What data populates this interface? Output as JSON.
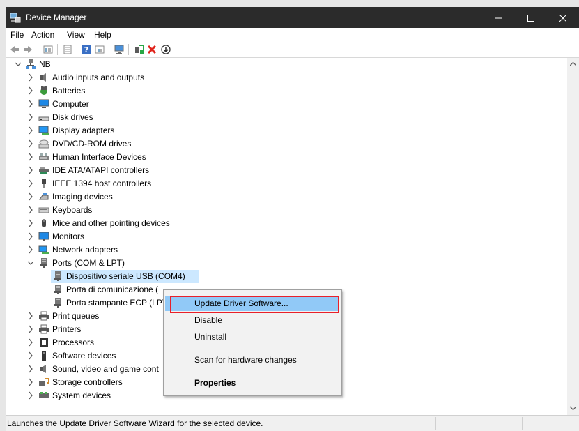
{
  "window": {
    "title": "Device Manager",
    "controls": {
      "minimize": "minimize",
      "maximize": "maximize",
      "close": "close"
    }
  },
  "menu": [
    "File",
    "Action",
    "View",
    "Help"
  ],
  "toolbar": {
    "icons": [
      "back-arrow-icon",
      "forward-arrow-icon",
      "properties-icon",
      "show-list-icon",
      "help-icon",
      "view-grid-icon",
      "monitor-icon",
      "add-legacy-icon",
      "uninstall-x-icon",
      "update-down-icon"
    ]
  },
  "tree": {
    "root": "NB",
    "items": [
      {
        "label": "Audio inputs and outputs",
        "icon": "speaker-icon",
        "expanded": false
      },
      {
        "label": "Batteries",
        "icon": "battery-icon",
        "expanded": false
      },
      {
        "label": "Computer",
        "icon": "computer-icon",
        "expanded": false
      },
      {
        "label": "Disk drives",
        "icon": "disk-drive-icon",
        "expanded": false
      },
      {
        "label": "Display adapters",
        "icon": "display-adapter-icon",
        "expanded": false
      },
      {
        "label": "DVD/CD-ROM drives",
        "icon": "dvd-icon",
        "expanded": false
      },
      {
        "label": "Human Interface Devices",
        "icon": "hid-icon",
        "expanded": false
      },
      {
        "label": "IDE ATA/ATAPI controllers",
        "icon": "ide-icon",
        "expanded": false
      },
      {
        "label": "IEEE 1394 host controllers",
        "icon": "ieee1394-icon",
        "expanded": false
      },
      {
        "label": "Imaging devices",
        "icon": "imaging-icon",
        "expanded": false
      },
      {
        "label": "Keyboards",
        "icon": "keyboard-icon",
        "expanded": false
      },
      {
        "label": "Mice and other pointing devices",
        "icon": "mouse-icon",
        "expanded": false
      },
      {
        "label": "Monitors",
        "icon": "monitor-icon",
        "expanded": false
      },
      {
        "label": "Network adapters",
        "icon": "network-icon",
        "expanded": false
      },
      {
        "label": "Ports (COM & LPT)",
        "icon": "port-icon",
        "expanded": true,
        "children": [
          {
            "label": "Dispositivo seriale USB (COM4)",
            "icon": "port-icon",
            "selected": true
          },
          {
            "label": "Porta di comunicazione (",
            "icon": "port-icon"
          },
          {
            "label": "Porta stampante ECP (LPT",
            "icon": "port-icon"
          }
        ]
      },
      {
        "label": "Print queues",
        "icon": "printer-icon",
        "expanded": false
      },
      {
        "label": "Printers",
        "icon": "printer-icon",
        "expanded": false
      },
      {
        "label": "Processors",
        "icon": "processor-icon",
        "expanded": false
      },
      {
        "label": "Software devices",
        "icon": "software-device-icon",
        "expanded": false
      },
      {
        "label": "Sound, video and game cont",
        "icon": "speaker-icon",
        "expanded": false
      },
      {
        "label": "Storage controllers",
        "icon": "storage-icon",
        "expanded": false
      },
      {
        "label": "System devices",
        "icon": "system-icon",
        "expanded": false
      }
    ]
  },
  "context_menu": {
    "items": [
      {
        "label": "Update Driver Software...",
        "hover": true
      },
      {
        "label": "Disable"
      },
      {
        "label": "Uninstall"
      },
      {
        "separator": true
      },
      {
        "label": "Scan for hardware changes"
      },
      {
        "separator": true
      },
      {
        "label": "Properties",
        "bold": true
      }
    ]
  },
  "status": {
    "text": "Launches the Update Driver Software Wizard for the selected device."
  },
  "colors": {
    "titlebar": "#2b2b2b",
    "selection": "#cce8ff",
    "menu_hover": "#91c9f7",
    "annotation_red": "#e8202a"
  }
}
